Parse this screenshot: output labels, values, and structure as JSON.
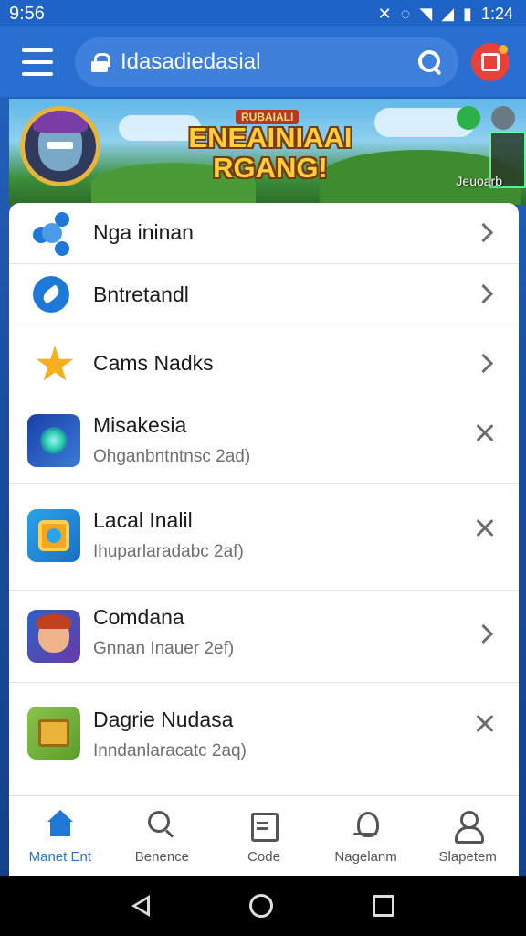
{
  "status_bar": {
    "time_left": "9:56",
    "time_right": "1:24",
    "icons": [
      "nfc-icon",
      "vibrate-icon",
      "wifi-icon",
      "signal-icon",
      "battery-icon"
    ]
  },
  "app_bar": {
    "search_text": "Idasadiedasial",
    "icons": [
      "menu-icon",
      "lock-icon",
      "search-icon",
      "profile-icon"
    ],
    "accent_color": "#2a6fd0"
  },
  "banner": {
    "super_label": "RUBAIALI",
    "title_line1": "ENEAINIAAI",
    "title_line2": "RGANG!",
    "tag": "Jeuoarb"
  },
  "list": [
    {
      "title": "Nga ininan",
      "subtitle": "",
      "icon": "share-icon",
      "action": "chevron-right-icon"
    },
    {
      "title": "Bntretandl",
      "subtitle": "",
      "icon": "bird-icon",
      "action": "chevron-right-icon"
    },
    {
      "title": "Cams Nadks",
      "subtitle": "",
      "icon": "star-mascot-icon",
      "action": "chevron-right-icon"
    },
    {
      "title": "Misakesia",
      "subtitle": "Ohganbntntnsc 2ad)",
      "icon": "misakesia-app-icon",
      "action": "close-icon"
    },
    {
      "title": "Lacal Inalil",
      "subtitle": "Ihuparlaradabc 2af)",
      "icon": "lacal-app-icon",
      "action": "close-icon"
    },
    {
      "title": "Comdana",
      "subtitle": "Gnnan Inauer 2ef)",
      "icon": "comdana-app-icon",
      "action": "chevron-right-icon"
    },
    {
      "title": "Dagrie Nudasa",
      "subtitle": "Inndanlaracatc 2aq)",
      "icon": "dagrie-app-icon",
      "action": "close-icon"
    }
  ],
  "bottom_nav": [
    {
      "label": "Manet Ent",
      "icon": "home-icon",
      "active": true
    },
    {
      "label": "Benence",
      "icon": "search-icon",
      "active": false
    },
    {
      "label": "Code",
      "icon": "code-icon",
      "active": false
    },
    {
      "label": "Nagelanm",
      "icon": "bell-icon",
      "active": false
    },
    {
      "label": "Slapetem",
      "icon": "user-icon",
      "active": false
    }
  ],
  "system_nav": [
    "back-icon",
    "home-circle-icon",
    "recents-icon"
  ],
  "colors": {
    "primary": "#1e78d6",
    "status_bar": "#1f63c6"
  }
}
